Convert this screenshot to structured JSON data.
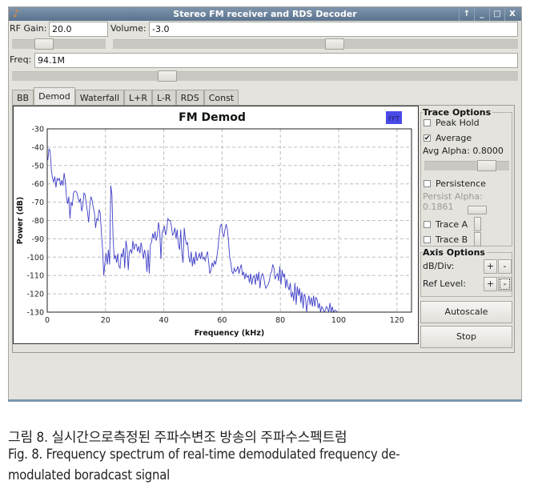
{
  "window": {
    "title": "Stereo FM receiver and RDS Decoder",
    "controls": [
      "pin-icon",
      "minimize-icon",
      "maximize-icon",
      "close-icon"
    ],
    "control_glyphs": [
      "↑",
      "_",
      "□",
      "X"
    ]
  },
  "controls": {
    "rf_gain": {
      "label": "RF Gain:",
      "value": "20.0",
      "slider_fraction": 0.3
    },
    "volume": {
      "label": "Volume:",
      "value": "-3.0",
      "slider_fraction": 0.55
    },
    "freq": {
      "label": "Freq:",
      "value": "94.1M",
      "slider_fraction": 0.3
    }
  },
  "tabs": [
    {
      "label": "BB",
      "active": false
    },
    {
      "label": "Demod",
      "active": true
    },
    {
      "label": "Waterfall",
      "active": false
    },
    {
      "label": "L+R",
      "active": false
    },
    {
      "label": "L-R",
      "active": false
    },
    {
      "label": "RDS",
      "active": false
    },
    {
      "label": "Const",
      "active": false
    }
  ],
  "fft_badge": {
    "label": "FFT",
    "color": "#4a4ae8"
  },
  "trace_options": {
    "title": "Trace Options",
    "peak_hold": {
      "label": "Peak Hold",
      "checked": false
    },
    "average": {
      "label": "Average",
      "checked": true
    },
    "avg_alpha": {
      "label": "Avg Alpha: 0.8000",
      "slider_fraction": 0.8
    },
    "persistence": {
      "label": "Persistence",
      "checked": false
    },
    "persist_alpha": {
      "label": "Persist Alpha: 0.1861",
      "slider_fraction": 0.19
    },
    "trace_a": {
      "label": "Trace A",
      "checked": false
    },
    "trace_b": {
      "label": "Trace B",
      "checked": false
    }
  },
  "axis_options": {
    "title": "Axis Options",
    "db_div": {
      "label": "dB/Div:",
      "plus": "+",
      "minus": "-"
    },
    "ref_level": {
      "label": "Ref Level:",
      "plus": "+",
      "minus": "-"
    }
  },
  "buttons": {
    "autoscale": "Autoscale",
    "stop": "Stop"
  },
  "caption": {
    "korean": "그림 8. 실시간으로측정된 주파수변조 방송의 주파수스펙트럼",
    "english_line1": "Fig. 8. Frequency spectrum of real-time demodulated frequency de-",
    "english_line2": "modulated boradcast signal"
  },
  "chart_data": {
    "type": "line",
    "title": "FM Demod",
    "xlabel": "Frequency (kHz)",
    "ylabel": "Power (dB)",
    "xlim": [
      0,
      125
    ],
    "ylim": [
      -130,
      -30
    ],
    "xticks": [
      0,
      20,
      40,
      60,
      80,
      100,
      120
    ],
    "yticks": [
      -30,
      -40,
      -50,
      -60,
      -70,
      -80,
      -90,
      -100,
      -110,
      -120,
      -130
    ],
    "grid": true,
    "line_color": "#4040c8",
    "series": [
      {
        "name": "FFT",
        "x": [
          0.2,
          0.6,
          1.0,
          1.4,
          1.8,
          2.2,
          2.6,
          3.0,
          3.4,
          3.8,
          4.2,
          4.6,
          5.0,
          5.4,
          5.8,
          6.2,
          6.6,
          7.0,
          7.4,
          7.8,
          8.2,
          8.6,
          9.0,
          9.4,
          9.8,
          10.2,
          10.6,
          11.0,
          11.4,
          11.8,
          12.2,
          12.6,
          13.0,
          13.4,
          13.8,
          14.2,
          14.6,
          15.0,
          15.4,
          15.8,
          16.2,
          16.6,
          17.0,
          17.4,
          17.8,
          18.2,
          18.6,
          19.0,
          19.4,
          19.8,
          20.2,
          20.6,
          21.0,
          21.4,
          21.8,
          22.2,
          22.6,
          23.0,
          23.4,
          23.8,
          24.2,
          24.6,
          25.0,
          25.4,
          25.8,
          26.2,
          26.6,
          27.0,
          27.4,
          27.8,
          28.2,
          28.6,
          29.0,
          29.4,
          29.8,
          30.2,
          30.6,
          31.0,
          31.4,
          31.8,
          32.2,
          32.6,
          33.0,
          33.4,
          33.8,
          34.2,
          34.6,
          35.0,
          35.4,
          35.8,
          36.2,
          36.6,
          37.0,
          37.4,
          37.8,
          38.2,
          38.6,
          39.0,
          39.4,
          39.8,
          40.2,
          40.6,
          41.0,
          41.4,
          41.8,
          42.2,
          42.6,
          43.0,
          43.4,
          43.8,
          44.2,
          44.6,
          45.0,
          45.4,
          45.8,
          46.2,
          46.6,
          47.0,
          47.4,
          47.8,
          48.2,
          48.6,
          49.0,
          49.4,
          49.8,
          50.2,
          50.6,
          51.0,
          51.4,
          51.8,
          52.2,
          52.6,
          53.0,
          53.4,
          53.8,
          54.2,
          54.6,
          55.0,
          55.4,
          55.8,
          56.2,
          56.6,
          57.0,
          57.4,
          57.8,
          58.2,
          58.6,
          59.0,
          59.4,
          59.8,
          60.2,
          60.6,
          61.0,
          61.4,
          61.8,
          62.2,
          62.6,
          63.0,
          63.4,
          63.8,
          64.2,
          64.6,
          65.0,
          65.4,
          65.8,
          66.2,
          66.6,
          67.0,
          67.4,
          67.8,
          68.2,
          68.6,
          69.0,
          69.4,
          69.8,
          70.2,
          70.6,
          71.0,
          71.4,
          71.8,
          72.2,
          72.6,
          73.0,
          73.4,
          73.8,
          74.2,
          74.6,
          75.0,
          75.4,
          75.8,
          76.2,
          76.6,
          77.0,
          77.4,
          77.8,
          78.2,
          78.6,
          79.0,
          79.4,
          79.8,
          80.2,
          80.6,
          81.0,
          81.4,
          81.8,
          82.2,
          82.6,
          83.0,
          83.4,
          83.8,
          84.2,
          84.6,
          85.0,
          85.4,
          85.8,
          86.2,
          86.6,
          87.0,
          87.4,
          87.8,
          88.2,
          88.6,
          89.0,
          89.4,
          89.8,
          90.2,
          90.6,
          91.0,
          91.4,
          91.8,
          92.2,
          92.6,
          93.0,
          93.4,
          93.8,
          94.2,
          94.6,
          95.0,
          95.4,
          95.8,
          96.2,
          96.6,
          97.0,
          97.4,
          97.8,
          98.2,
          98.6,
          99.0,
          99.4,
          99.8
        ],
        "y": [
          -47,
          -41,
          -42,
          -52,
          -57,
          -59,
          -56,
          -62,
          -57,
          -58,
          -57,
          -61,
          -58,
          -61,
          -54,
          -59,
          -67,
          -71,
          -67,
          -79,
          -70,
          -72,
          -65,
          -64,
          -64,
          -65,
          -68,
          -70,
          -68,
          -75,
          -72,
          -65,
          -66,
          -71,
          -75,
          -81,
          -72,
          -67,
          -69,
          -73,
          -76,
          -84,
          -79,
          -80,
          -74,
          -76,
          -87,
          -96,
          -110,
          -103,
          -98,
          -104,
          -96,
          -104,
          -61,
          -66,
          -90,
          -101,
          -99,
          -103,
          -98,
          -105,
          -106,
          -98,
          -100,
          -95,
          -106,
          -91,
          -95,
          -107,
          -97,
          -96,
          -98,
          -91,
          -96,
          -93,
          -93,
          -97,
          -94,
          -98,
          -92,
          -96,
          -101,
          -96,
          -99,
          -108,
          -96,
          -109,
          -93,
          -92,
          -87,
          -90,
          -86,
          -91,
          -88,
          -81,
          -86,
          -101,
          -87,
          -85,
          -83,
          -88,
          -85,
          -79,
          -80,
          -80,
          -83,
          -88,
          -87,
          -84,
          -90,
          -85,
          -93,
          -96,
          -85,
          -98,
          -103,
          -84,
          -90,
          -93,
          -92,
          -100,
          -103,
          -97,
          -105,
          -100,
          -104,
          -97,
          -102,
          -100,
          -98,
          -101,
          -97,
          -101,
          -100,
          -102,
          -99,
          -97,
          -103,
          -109,
          -107,
          -103,
          -105,
          -102,
          -104,
          -100,
          -95,
          -88,
          -83,
          -82,
          -87,
          -89,
          -85,
          -82,
          -85,
          -91,
          -100,
          -103,
          -108,
          -109,
          -106,
          -108,
          -107,
          -105,
          -109,
          -106,
          -104,
          -110,
          -108,
          -112,
          -109,
          -111,
          -110,
          -114,
          -109,
          -115,
          -111,
          -110,
          -115,
          -109,
          -113,
          -108,
          -117,
          -111,
          -109,
          -110,
          -114,
          -117,
          -116,
          -115,
          -113,
          -109,
          -108,
          -104,
          -106,
          -112,
          -110,
          -109,
          -113,
          -105,
          -115,
          -107,
          -111,
          -109,
          -117,
          -112,
          -116,
          -118,
          -114,
          -122,
          -119,
          -124,
          -114,
          -126,
          -116,
          -121,
          -117,
          -125,
          -119,
          -128,
          -120,
          -122,
          -130,
          -124,
          -121,
          -126,
          -122,
          -127,
          -121,
          -127,
          -122,
          -123,
          -128,
          -125,
          -130,
          -127,
          -128,
          -130,
          -129,
          -127,
          -128,
          -130,
          -125,
          -130,
          -127,
          -130,
          -129,
          -129,
          -130,
          -130,
          -127,
          -130,
          -130,
          -130,
          -130,
          -126,
          -130
        ]
      }
    ]
  }
}
